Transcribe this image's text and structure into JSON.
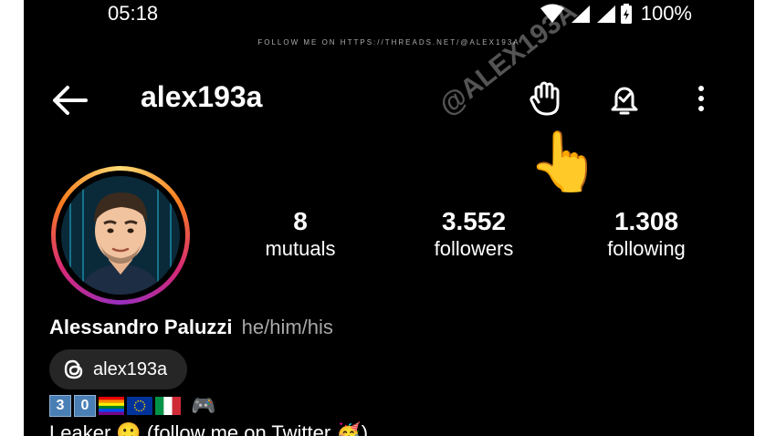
{
  "status_bar": {
    "time": "05:18",
    "battery": "100%"
  },
  "watermark": {
    "top": "FOLLOW ME ON HTTPS://THREADS.NET/@ALEX193A",
    "diagonal": "@ALEX193A"
  },
  "header": {
    "title": "alex193a",
    "icons": [
      "back-arrow-icon",
      "wave-hand-icon",
      "bell-check-icon",
      "more-vert-icon"
    ]
  },
  "stats": [
    {
      "value": "8",
      "label": "mutuals"
    },
    {
      "value": "3.552",
      "label": "followers"
    },
    {
      "value": "1.308",
      "label": "following"
    }
  ],
  "profile": {
    "name": "Alessandro Paluzzi",
    "pronouns": "he/him/his",
    "threads_handle": "alex193a"
  },
  "bio": {
    "digits": [
      "3",
      "0"
    ],
    "line": "Leaker 🙂 (follow me on Twitter 🥳)"
  },
  "colors": {
    "background": "#000000",
    "chip": "#262626",
    "muted": "#a8a8a8"
  }
}
